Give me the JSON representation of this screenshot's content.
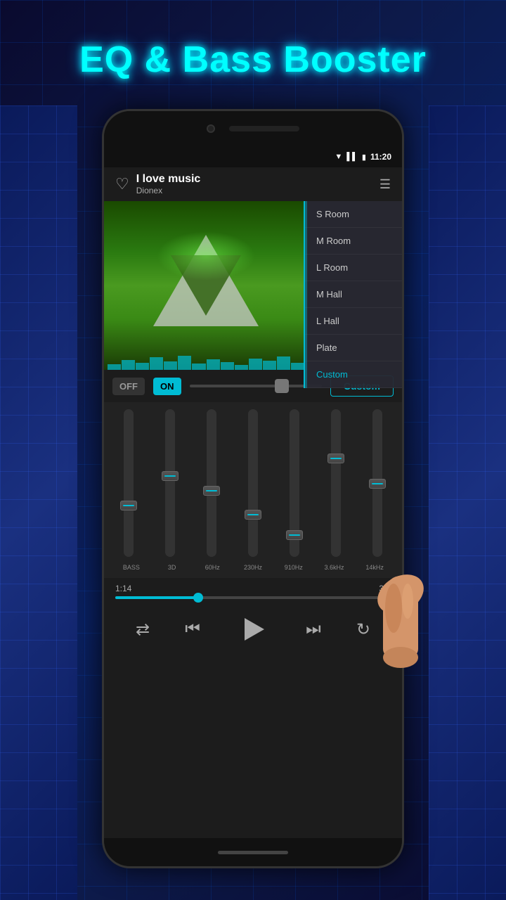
{
  "app": {
    "title": "EQ & Bass Booster"
  },
  "statusBar": {
    "time": "11:20",
    "signal": "▼",
    "bars": "▌",
    "battery": "▮"
  },
  "song": {
    "title": "I love music",
    "artist": "Dionex",
    "currentTime": "1:14",
    "totalTime": "3:5"
  },
  "toggle": {
    "off_label": "OFF",
    "on_label": "ON",
    "custom_label": "Custom"
  },
  "presets": [
    {
      "label": "S Room",
      "active": false
    },
    {
      "label": "M Room",
      "active": false
    },
    {
      "label": "L Room",
      "active": false
    },
    {
      "label": "M Hall",
      "active": false
    },
    {
      "label": "L Hall",
      "active": false
    },
    {
      "label": "Plate",
      "active": false
    },
    {
      "label": "Custom",
      "active": true
    }
  ],
  "eq": {
    "channels": [
      {
        "label": "BASS",
        "thumbPos": 65
      },
      {
        "label": "3D",
        "thumbPos": 45
      },
      {
        "label": "60Hz",
        "thumbPos": 55
      },
      {
        "label": "230Hz",
        "thumbPos": 70
      },
      {
        "label": "910Hz",
        "thumbPos": 85
      },
      {
        "label": "3.6kHz",
        "thumbPos": 35
      },
      {
        "label": "14kHz",
        "thumbPos": 50
      }
    ]
  },
  "controls": {
    "shuffle": "⇄",
    "prev": "⏮",
    "play": "▶",
    "next": "⏭",
    "repeat": "↻"
  }
}
